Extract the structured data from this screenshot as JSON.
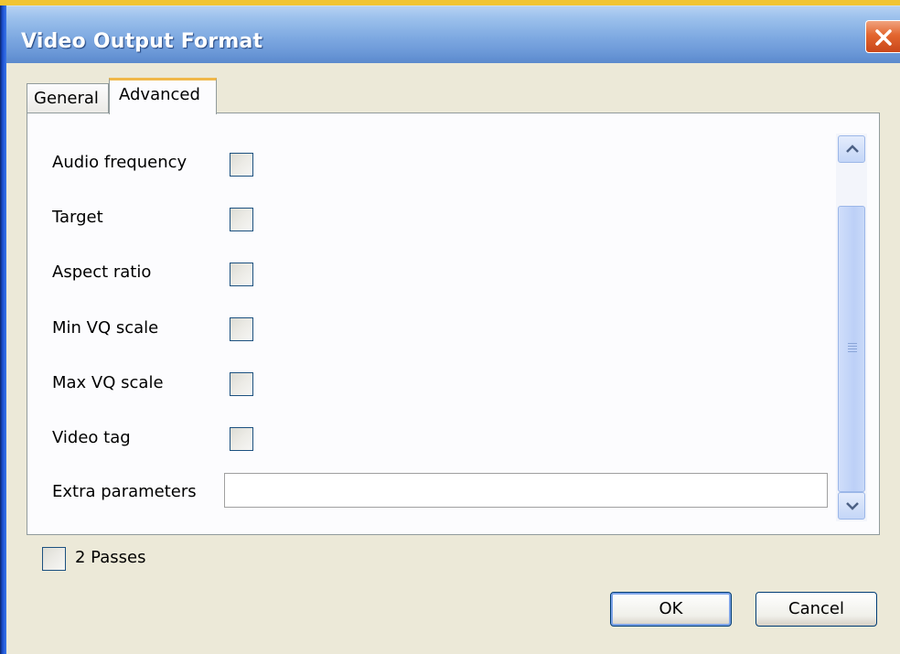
{
  "window": {
    "title": "Video Output Format"
  },
  "tabs": [
    {
      "label": "General"
    },
    {
      "label": "Advanced"
    }
  ],
  "advanced": {
    "fields": [
      {
        "label": "Audio frequency",
        "checked": false
      },
      {
        "label": "Target",
        "checked": false
      },
      {
        "label": "Aspect ratio",
        "checked": false
      },
      {
        "label": "Min VQ scale",
        "checked": false
      },
      {
        "label": "Max VQ scale",
        "checked": false
      },
      {
        "label": "Video tag",
        "checked": false
      }
    ],
    "extra_parameters": {
      "label": "Extra parameters",
      "value": ""
    }
  },
  "two_passes": {
    "label": "2 Passes",
    "checked": false
  },
  "buttons": {
    "ok_label": "OK",
    "cancel_label": "Cancel"
  },
  "icons": {
    "close": "close-icon",
    "scroll_up": "chevron-up-icon",
    "scroll_down": "chevron-down-icon",
    "scroll_grip": "grip-icon"
  },
  "colors": {
    "titlebar": "#7ea9e1",
    "close_button": "#e3662f",
    "active_tab_accent": "#f0b84a",
    "window_background": "#ece9d8"
  }
}
